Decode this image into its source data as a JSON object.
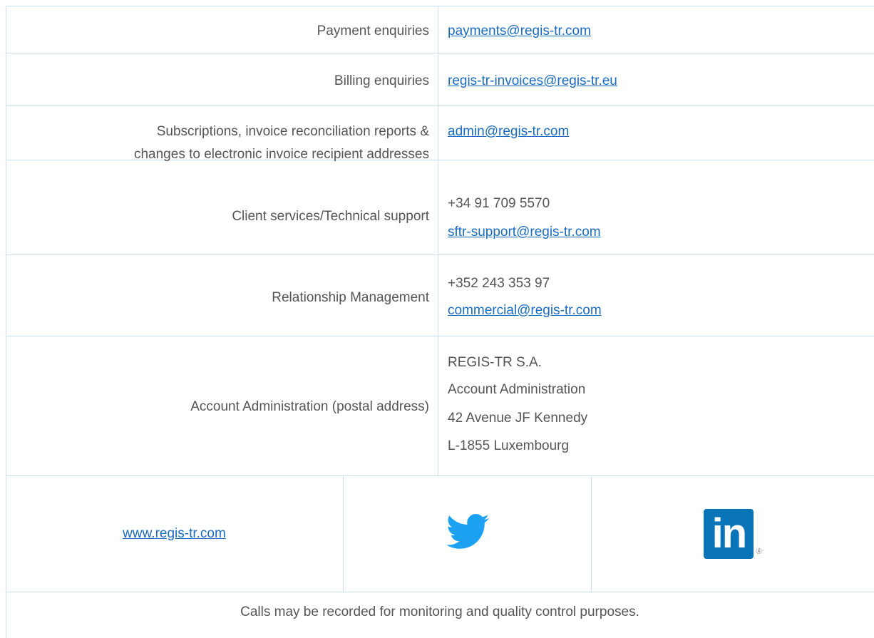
{
  "contacts": [
    {
      "label": "Payment enquiries",
      "email": "payments@regis-tr.com"
    },
    {
      "label": "Billing enquiries",
      "email": "regis-tr-invoices@regis-tr.eu"
    },
    {
      "label_line1": "Subscriptions, invoice reconciliation reports &",
      "label_line2": "changes to electronic invoice recipient addresses",
      "email": "admin@regis-tr.com"
    },
    {
      "label": "Client services/Technical support",
      "phone": "+34 91 709 5570",
      "email": "sftr-support@regis-tr.com"
    },
    {
      "label": "Relationship Management",
      "phone": "+352 243 353 97",
      "email": "commercial@regis-tr.com"
    },
    {
      "label": "Account Administration (postal address)",
      "address": [
        "REGIS-TR S.A.",
        "Account Administration",
        "42 Avenue JF Kennedy",
        "L-1855 Luxembourg"
      ]
    }
  ],
  "links": {
    "website": "www.regis-tr.com",
    "twitter_icon": "twitter-bird-icon",
    "linkedin_icon": "linkedin-icon",
    "linkedin_text": "in",
    "linkedin_mark": "®"
  },
  "footer": {
    "note": "Calls may be recorded for monitoring and quality control purposes."
  },
  "colors": {
    "border": "#c9dff0",
    "link": "#1a6bbf",
    "text": "#555555",
    "twitter": "#1da1f2",
    "linkedin": "#0a74b8"
  }
}
